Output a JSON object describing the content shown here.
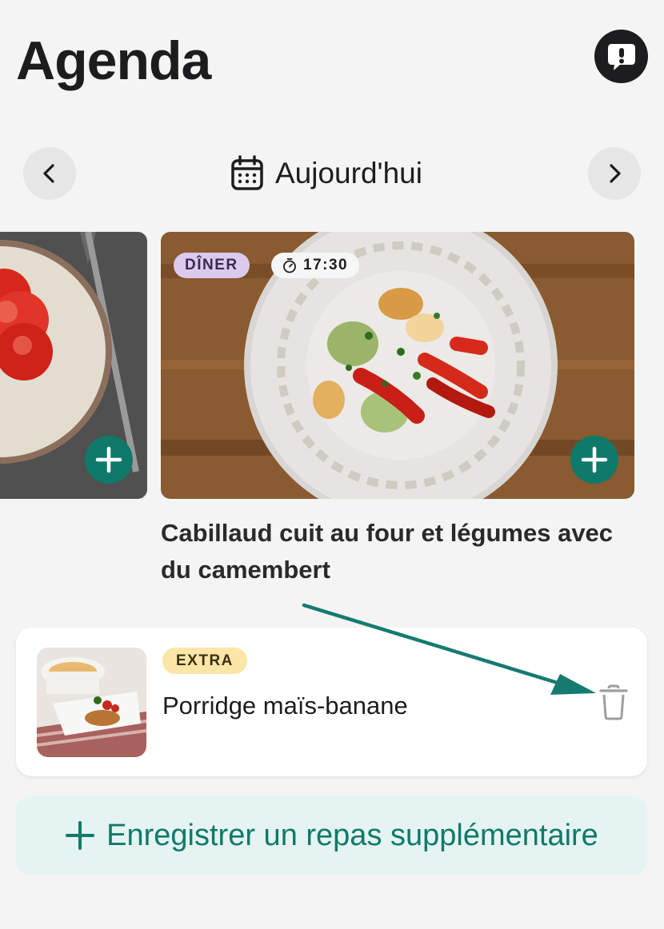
{
  "header": {
    "title": "Agenda",
    "feedback_icon": "exclamation-bubble-icon"
  },
  "date_nav": {
    "label": "Aujourd'hui",
    "prev_icon": "chevron-left-icon",
    "next_icon": "chevron-right-icon",
    "calendar_icon": "calendar-icon"
  },
  "meals": [
    {
      "photo": "tomato-plate-photo"
    },
    {
      "type_tag": "DÎNER",
      "time": "17:30",
      "title": "Cabillaud cuit au four et légumes avec du camembert"
    }
  ],
  "extras": [
    {
      "tag": "EXTRA",
      "name": "Porridge maïs-banane"
    }
  ],
  "add_extra": {
    "label": "Enregistrer un repas supplémentaire"
  },
  "colors": {
    "accent": "#0f7a69",
    "diner_tag": "#dcc9ee",
    "extra_tag": "#fbe6a7",
    "add_extra_bg": "#e5f3f2",
    "annotation_arrow": "#167a70"
  }
}
